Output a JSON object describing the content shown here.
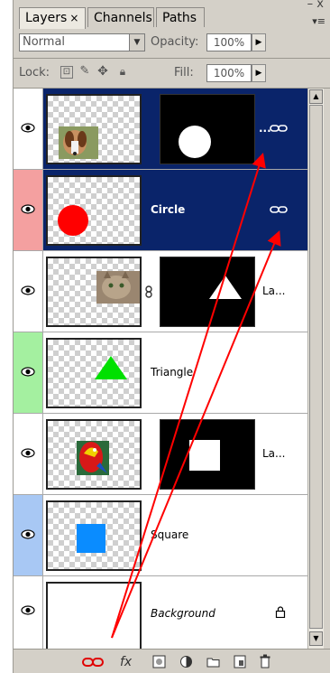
{
  "tabs": [
    {
      "label": "Layers",
      "close": "×",
      "active": true
    },
    {
      "label": "Channels",
      "active": false
    },
    {
      "label": "Paths",
      "active": false
    }
  ],
  "panel": {
    "close": "–  x",
    "menu": "▾≡"
  },
  "blend_mode": {
    "value": "Normal"
  },
  "opacity": {
    "label": "Opacity:",
    "value": "100%"
  },
  "lock": {
    "label": "Lock:"
  },
  "fill": {
    "label": "Fill:",
    "value": "100%"
  },
  "layers": [
    {
      "name": "...",
      "selected": true,
      "eye_bg": "#ffffff",
      "has_mask": true,
      "thumb": "dog",
      "mask": "circle",
      "linked": true
    },
    {
      "name": "Circle",
      "selected": true,
      "eye_bg": "#f4a0a0",
      "has_mask": false,
      "thumb": "red-circle",
      "linked": true
    },
    {
      "name": "La...",
      "selected": false,
      "eye_bg": "#ffffff",
      "has_mask": true,
      "thumb": "cat",
      "mask": "triangle",
      "linked": false
    },
    {
      "name": "Triangle",
      "selected": false,
      "eye_bg": "#a4f0a0",
      "has_mask": false,
      "thumb": "green-triangle",
      "linked": false
    },
    {
      "name": "La...",
      "selected": false,
      "eye_bg": "#ffffff",
      "has_mask": true,
      "thumb": "parrot",
      "mask": "square",
      "linked": false
    },
    {
      "name": "Square",
      "selected": false,
      "eye_bg": "#a8c8f4",
      "has_mask": false,
      "thumb": "blue-square",
      "linked": false
    },
    {
      "name": "Background",
      "selected": false,
      "eye_bg": "#ffffff",
      "has_mask": false,
      "thumb": "white",
      "locked": true
    }
  ],
  "bottom_icons": [
    "link-layers-icon",
    "fx-icon",
    "add-mask-icon",
    "adjustment-icon",
    "new-group-icon",
    "new-layer-icon",
    "delete-layer-icon"
  ],
  "colors": {
    "selection": "#0a246a",
    "arrow": "#ff0000"
  }
}
